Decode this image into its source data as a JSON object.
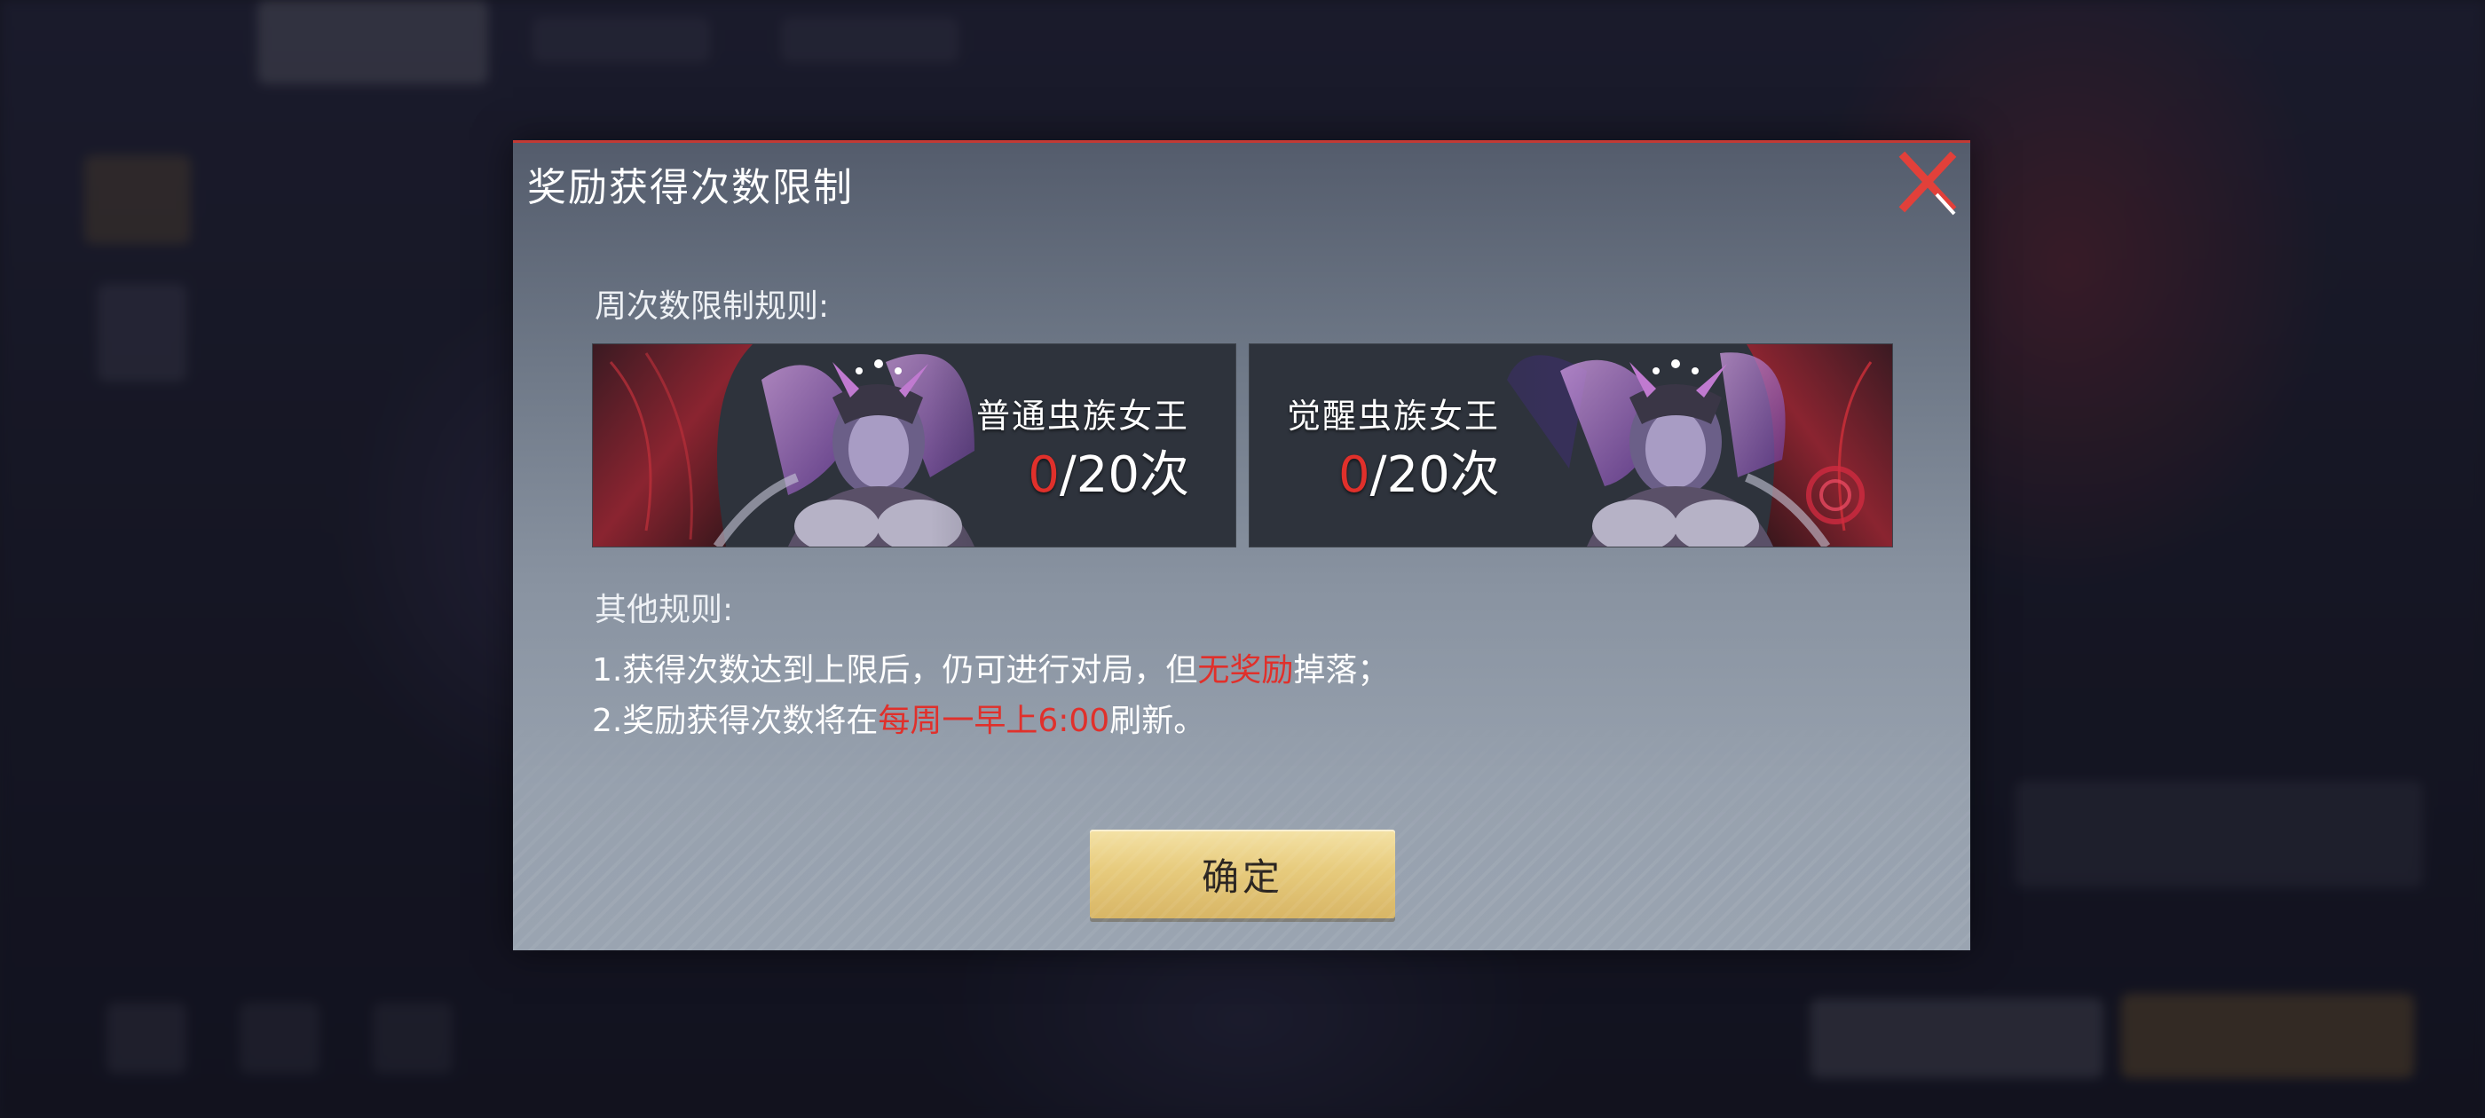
{
  "dialog": {
    "title": "奖励获得次数限制",
    "close_icon": "close-icon",
    "weekly_rules_label": "周次数限制规则:",
    "bosses": [
      {
        "name": "普通虫族女王",
        "count": "0",
        "limit_text": "/20次"
      },
      {
        "name": "觉醒虫族女王",
        "count": "0",
        "limit_text": "/20次"
      }
    ],
    "other_rules_label": "其他规则:",
    "rule_1": {
      "prefix": "1.获得次数达到上限后，仍可进行对局，但",
      "highlight": "无奖励",
      "suffix": "掉落；"
    },
    "rule_2": {
      "prefix": "2.奖励获得次数将在",
      "highlight": "每周一早上6:00",
      "suffix": "刷新。"
    },
    "confirm_label": "确定"
  },
  "colors": {
    "accent_red": "#e0302b",
    "button_gold": "#e7cb7d",
    "dialog_border": "#c23a35"
  }
}
